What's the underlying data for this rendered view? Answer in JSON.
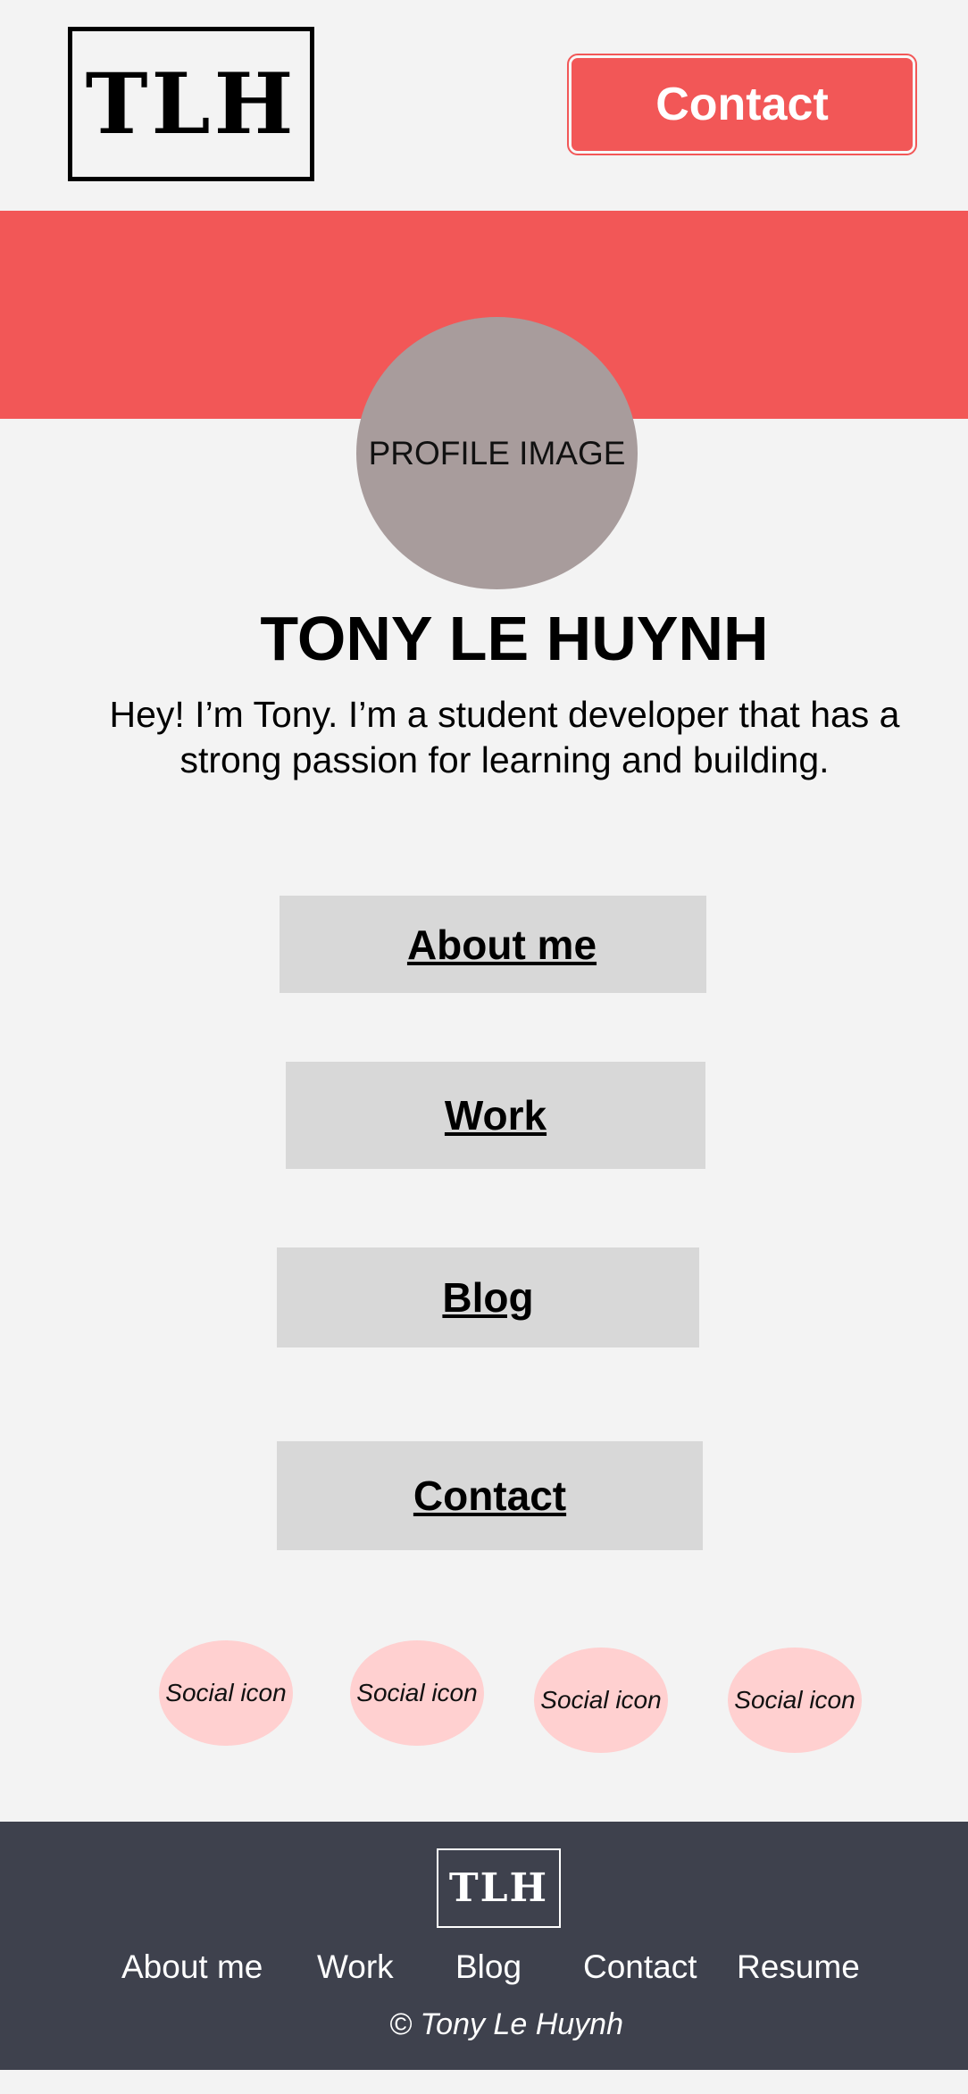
{
  "header": {
    "logo_text": "TLH",
    "contact_button": "Contact"
  },
  "hero": {
    "profile_image_label": "PROFILE IMAGE",
    "name": "TONY LE HUYNH",
    "tagline_line1": "Hey! I’m Tony. I’m a student developer that has a",
    "tagline_line2": "strong passion for learning and building."
  },
  "nav": {
    "items": [
      {
        "label": "About me"
      },
      {
        "label": "Work"
      },
      {
        "label": "Blog"
      },
      {
        "label": "Contact"
      }
    ]
  },
  "social": {
    "icons": [
      {
        "label": "Social icon"
      },
      {
        "label": "Social icon"
      },
      {
        "label": "Social icon"
      },
      {
        "label": "Social icon"
      }
    ]
  },
  "footer": {
    "logo_text": "TLH",
    "links": [
      {
        "label": "About me"
      },
      {
        "label": "Work"
      },
      {
        "label": "Blog"
      },
      {
        "label": "Contact"
      },
      {
        "label": "Resume"
      }
    ],
    "copyright": "© Tony Le Huynh"
  },
  "colors": {
    "accent": "#f25757",
    "page_background": "#f3f3f3",
    "profile_placeholder": "#a89c9c",
    "nav_button": "#d8d8d8",
    "social_icon": "#ffd0d0",
    "footer_background": "#3e414d"
  }
}
